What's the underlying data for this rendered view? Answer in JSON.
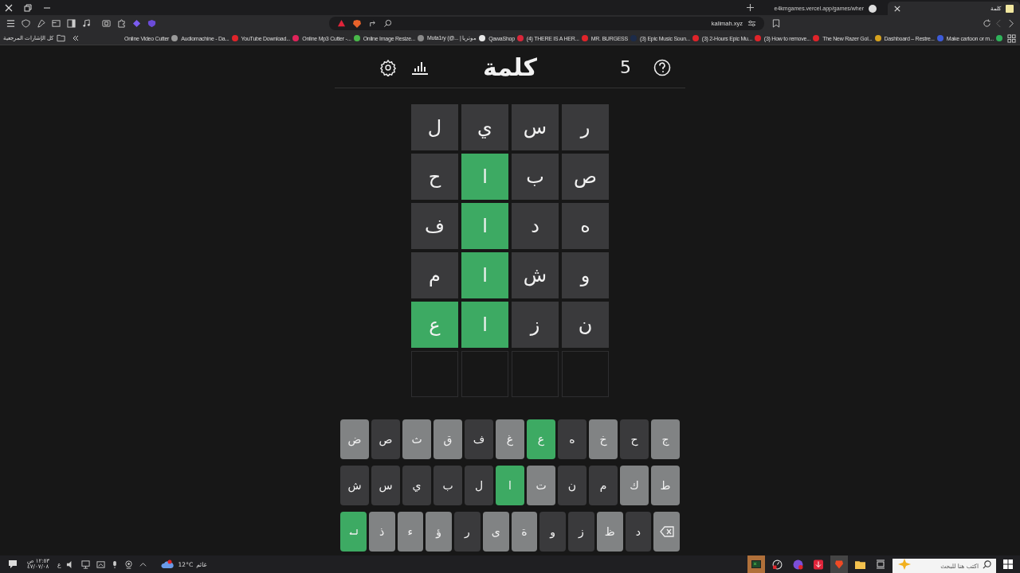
{
  "browser": {
    "tabs": [
      {
        "title": "كلمة",
        "selected": true
      },
      {
        "title": "e4kmgames.vercel.app/games/wher",
        "selected": false
      }
    ],
    "address": "kalimah.xyz",
    "bookmarks": [
      {
        "title": "Make cartoon or m...",
        "color": "#2fb35a"
      },
      {
        "title": "Dashboard – Restre...",
        "color": "#3d5bd9"
      },
      {
        "title": "The New Razer Gol...",
        "color": "#d6a21e"
      },
      {
        "title": "(3) How to remove...",
        "color": "#e0242a"
      },
      {
        "title": "(3) 2-Hours Epic Mu...",
        "color": "#e0242a"
      },
      {
        "title": "(3) Epic Music Soun...",
        "color": "#e0242a"
      },
      {
        "title": "MR. BURGESS",
        "color": "#1c2b4a"
      },
      {
        "title": "(4) THERE IS A HER...",
        "color": "#e0242a"
      },
      {
        "title": "QawaShop",
        "color": "#d9263a"
      },
      {
        "title": "Muta1ry (@... | موتريا",
        "color": "#e8e8e8"
      },
      {
        "title": "Online Image Resize...",
        "color": "#8a8a8a"
      },
      {
        "title": "Online Mp3 Cutter -...",
        "color": "#49b84a"
      },
      {
        "title": "YouTube Download...",
        "color": "#e0245a"
      },
      {
        "title": "Audiomachine - Da...",
        "color": "#e0242a"
      },
      {
        "title": "Online Video Cutter",
        "color": "#9a9a9a"
      }
    ],
    "bookmarks_folder": "كل الإشارات المرجعية"
  },
  "game": {
    "streak": "5",
    "title": "كلمة",
    "grid": [
      [
        {
          "kind": "letter",
          "letter": "ر",
          "correct": false
        },
        {
          "kind": "letter",
          "letter": "س",
          "correct": false
        },
        {
          "kind": "letter",
          "letter": "ي",
          "correct": false
        },
        {
          "kind": "letter",
          "letter": "ل",
          "correct": false
        }
      ],
      [
        {
          "kind": "letter",
          "letter": "ص",
          "correct": false
        },
        {
          "kind": "letter",
          "letter": "ب",
          "correct": false
        },
        {
          "kind": "letter",
          "letter": "ا",
          "correct": true
        },
        {
          "kind": "letter",
          "letter": "ح",
          "correct": false
        }
      ],
      [
        {
          "kind": "letter",
          "letter": "ه",
          "correct": false
        },
        {
          "kind": "letter",
          "letter": "د",
          "correct": false
        },
        {
          "kind": "letter",
          "letter": "ا",
          "correct": true
        },
        {
          "kind": "letter",
          "letter": "ف",
          "correct": false
        }
      ],
      [
        {
          "kind": "letter",
          "letter": "و",
          "correct": false
        },
        {
          "kind": "letter",
          "letter": "ش",
          "correct": false
        },
        {
          "kind": "letter",
          "letter": "ا",
          "correct": true
        },
        {
          "kind": "letter",
          "letter": "م",
          "correct": false
        }
      ],
      [
        {
          "kind": "letter",
          "letter": "ن",
          "correct": false
        },
        {
          "kind": "letter",
          "letter": "ز",
          "correct": false
        },
        {
          "kind": "letter",
          "letter": "ا",
          "correct": true
        },
        {
          "kind": "letter",
          "letter": "ع",
          "correct": true
        }
      ],
      [
        {
          "kind": "empty"
        },
        {
          "kind": "empty"
        },
        {
          "kind": "empty"
        },
        {
          "kind": "empty"
        }
      ]
    ],
    "keyboard": [
      [
        {
          "kind": "letter",
          "label": "ج",
          "correct": false,
          "absent": false
        },
        {
          "kind": "letter",
          "label": "ح",
          "correct": false,
          "absent": true
        },
        {
          "kind": "letter",
          "label": "خ",
          "correct": false,
          "absent": false
        },
        {
          "kind": "letter",
          "label": "ه",
          "correct": false,
          "absent": true
        },
        {
          "kind": "letter",
          "label": "ع",
          "correct": true,
          "absent": false
        },
        {
          "kind": "letter",
          "label": "غ",
          "correct": false,
          "absent": false
        },
        {
          "kind": "letter",
          "label": "ف",
          "correct": false,
          "absent": true
        },
        {
          "kind": "letter",
          "label": "ق",
          "correct": false,
          "absent": false
        },
        {
          "kind": "letter",
          "label": "ث",
          "correct": false,
          "absent": false
        },
        {
          "kind": "letter",
          "label": "ص",
          "correct": false,
          "absent": true
        },
        {
          "kind": "letter",
          "label": "ض",
          "correct": false,
          "absent": false
        }
      ],
      [
        {
          "kind": "letter",
          "label": "ط",
          "correct": false,
          "absent": false
        },
        {
          "kind": "letter",
          "label": "ك",
          "correct": false,
          "absent": false
        },
        {
          "kind": "letter",
          "label": "م",
          "correct": false,
          "absent": true
        },
        {
          "kind": "letter",
          "label": "ن",
          "correct": false,
          "absent": true
        },
        {
          "kind": "letter",
          "label": "ت",
          "correct": false,
          "absent": false
        },
        {
          "kind": "letter",
          "label": "ا",
          "correct": true,
          "absent": false
        },
        {
          "kind": "letter",
          "label": "ل",
          "correct": false,
          "absent": true
        },
        {
          "kind": "letter",
          "label": "ب",
          "correct": false,
          "absent": true
        },
        {
          "kind": "letter",
          "label": "ي",
          "correct": false,
          "absent": true
        },
        {
          "kind": "letter",
          "label": "س",
          "correct": false,
          "absent": true
        },
        {
          "kind": "letter",
          "label": "ش",
          "correct": false,
          "absent": true
        }
      ],
      [
        {
          "kind": "backspace"
        },
        {
          "kind": "letter",
          "label": "د",
          "correct": false,
          "absent": true
        },
        {
          "kind": "letter",
          "label": "ظ",
          "correct": false,
          "absent": false
        },
        {
          "kind": "letter",
          "label": "ز",
          "correct": false,
          "absent": true
        },
        {
          "kind": "letter",
          "label": "و",
          "correct": false,
          "absent": true
        },
        {
          "kind": "letter",
          "label": "ة",
          "correct": false,
          "absent": false
        },
        {
          "kind": "letter",
          "label": "ى",
          "correct": false,
          "absent": false
        },
        {
          "kind": "letter",
          "label": "ر",
          "correct": false,
          "absent": true
        },
        {
          "kind": "letter",
          "label": "ؤ",
          "correct": false,
          "absent": false
        },
        {
          "kind": "letter",
          "label": "ء",
          "correct": false,
          "absent": false
        },
        {
          "kind": "letter",
          "label": "ذ",
          "correct": false,
          "absent": false
        },
        {
          "kind": "enter"
        }
      ]
    ]
  },
  "taskbar": {
    "search_placeholder": "اكتب هنا للبحث",
    "weather": "غائم",
    "temperature": "12°C",
    "language": "ع",
    "time": "١٢:٥٣ ص",
    "date": "٤٧/٠٧/٠٨"
  }
}
